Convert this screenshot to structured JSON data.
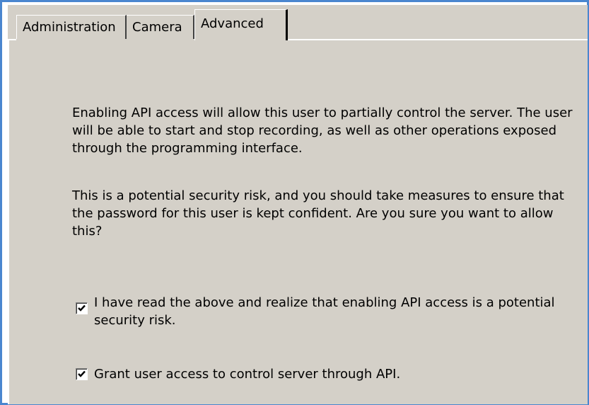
{
  "tabs": [
    {
      "label": "Administration",
      "selected": false
    },
    {
      "label": "Camera",
      "selected": false
    },
    {
      "label": "Advanced",
      "selected": true
    }
  ],
  "content": {
    "paragraph1": "Enabling API access will allow this user to partially control the server. The user will be able to start and stop recording, as well as other operations exposed through the programming interface.",
    "paragraph2": "This is a potential security risk, and you should take measures to ensure that the password for this user is kept confident. Are you sure you want to allow this?"
  },
  "checkboxes": [
    {
      "label": "I have read the above and realize that enabling API access is a potential security risk.",
      "checked": true
    },
    {
      "label": "Grant user access to control server through API.",
      "checked": true
    }
  ],
  "colors": {
    "window_border": "#4a86cf",
    "panel_background": "#d4d0c8"
  },
  "icons": {
    "checkmark": "checkmark-icon"
  }
}
